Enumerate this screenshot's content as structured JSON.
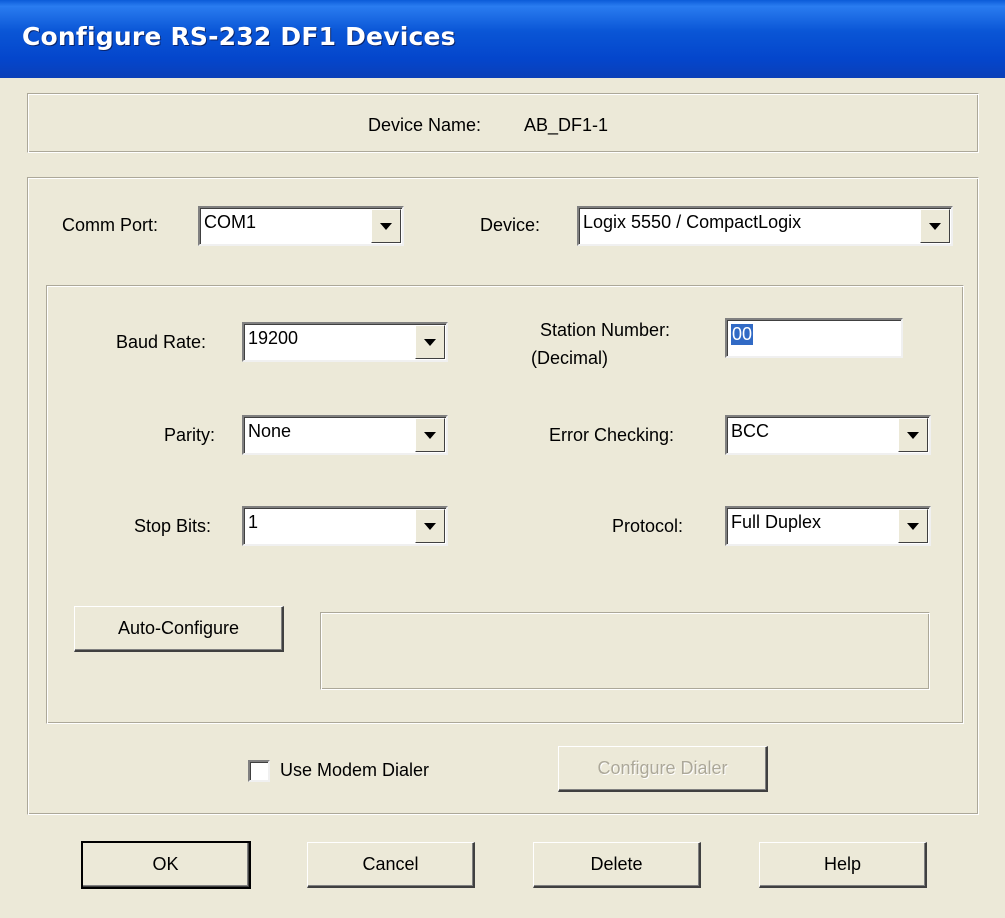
{
  "window": {
    "title": "Configure RS-232 DF1 Devices"
  },
  "device_name": {
    "label": "Device Name:",
    "value": "AB_DF1-1"
  },
  "comm_port": {
    "label": "Comm Port:",
    "value": "COM1"
  },
  "device": {
    "label": "Device:",
    "value": "Logix 5550 / CompactLogix"
  },
  "baud_rate": {
    "label": "Baud Rate:",
    "value": "19200"
  },
  "station_number": {
    "label": "Station Number:",
    "sublabel": "(Decimal)",
    "value": "00"
  },
  "parity": {
    "label": "Parity:",
    "value": "None"
  },
  "error_checking": {
    "label": "Error Checking:",
    "value": "BCC"
  },
  "stop_bits": {
    "label": "Stop Bits:",
    "value": "1"
  },
  "protocol": {
    "label": "Protocol:",
    "value": "Full Duplex"
  },
  "auto_configure": {
    "label": "Auto-Configure"
  },
  "modem": {
    "label": "Use Modem Dialer",
    "checked": false
  },
  "configure_dialer": {
    "label": "Configure Dialer"
  },
  "buttons": {
    "ok": "OK",
    "cancel": "Cancel",
    "delete": "Delete",
    "help": "Help"
  }
}
